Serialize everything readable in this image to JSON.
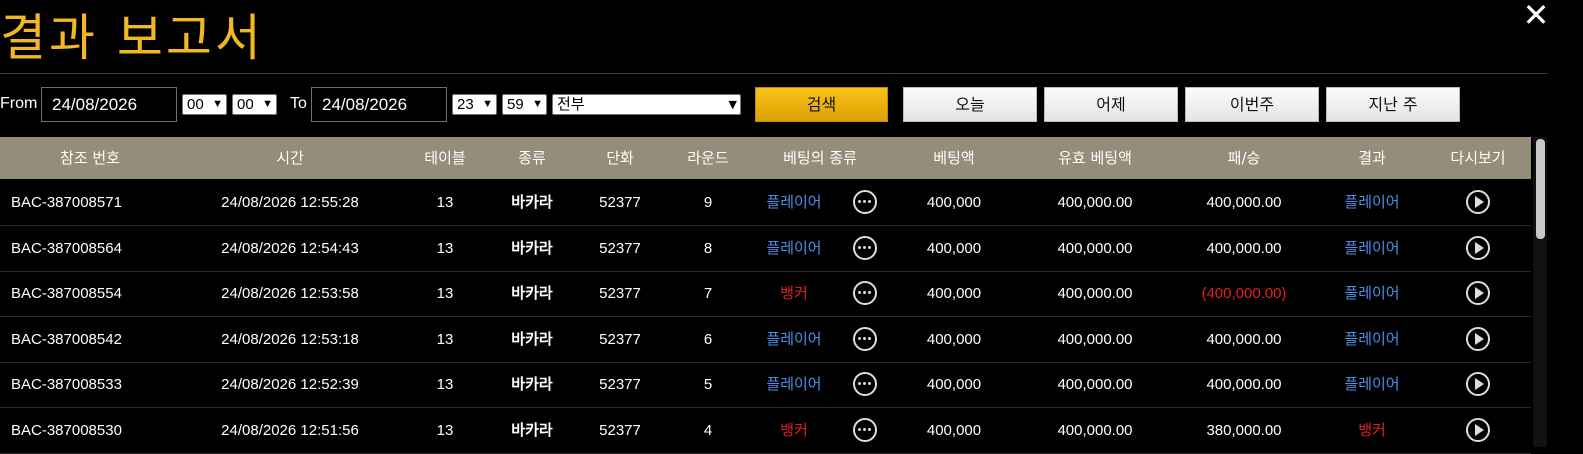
{
  "header": {
    "title": "결과 보고서",
    "close_glyph": "✕"
  },
  "filters": {
    "from_label": "From",
    "from_date": "24/08/2026",
    "from_hour": "00",
    "from_minute": "00",
    "to_label": "To",
    "to_date": "24/08/2026",
    "to_hour": "23",
    "to_minute": "59",
    "category": "전부",
    "search_label": "검색",
    "today_label": "오늘",
    "yesterday_label": "어제",
    "this_week_label": "이번주",
    "last_week_label": "지난 주"
  },
  "table": {
    "columns": [
      "참조 번호",
      "시간",
      "테이블",
      "종류",
      "단화",
      "라운드",
      "베팅의 종류",
      "베팅액",
      "유효 베팅액",
      "패/승",
      "결과",
      "다시보기"
    ],
    "rows": [
      {
        "ref": "BAC-387008571",
        "time": "24/08/2026 12:55:28",
        "table": "13",
        "game": "바카라",
        "shoe": "52377",
        "round": "9",
        "bet_type": "플레이어",
        "bet_color": "blue",
        "amount": "400,000",
        "valid": "400,000.00",
        "winloss": "400,000.00",
        "winloss_color": "white",
        "result": "플레이어",
        "result_color": "blue"
      },
      {
        "ref": "BAC-387008564",
        "time": "24/08/2026 12:54:43",
        "table": "13",
        "game": "바카라",
        "shoe": "52377",
        "round": "8",
        "bet_type": "플레이어",
        "bet_color": "blue",
        "amount": "400,000",
        "valid": "400,000.00",
        "winloss": "400,000.00",
        "winloss_color": "white",
        "result": "플레이어",
        "result_color": "blue"
      },
      {
        "ref": "BAC-387008554",
        "time": "24/08/2026 12:53:58",
        "table": "13",
        "game": "바카라",
        "shoe": "52377",
        "round": "7",
        "bet_type": "뱅커",
        "bet_color": "red",
        "amount": "400,000",
        "valid": "400,000.00",
        "winloss": "(400,000.00)",
        "winloss_color": "red",
        "result": "플레이어",
        "result_color": "blue"
      },
      {
        "ref": "BAC-387008542",
        "time": "24/08/2026 12:53:18",
        "table": "13",
        "game": "바카라",
        "shoe": "52377",
        "round": "6",
        "bet_type": "플레이어",
        "bet_color": "blue",
        "amount": "400,000",
        "valid": "400,000.00",
        "winloss": "400,000.00",
        "winloss_color": "white",
        "result": "플레이어",
        "result_color": "blue"
      },
      {
        "ref": "BAC-387008533",
        "time": "24/08/2026 12:52:39",
        "table": "13",
        "game": "바카라",
        "shoe": "52377",
        "round": "5",
        "bet_type": "플레이어",
        "bet_color": "blue",
        "amount": "400,000",
        "valid": "400,000.00",
        "winloss": "400,000.00",
        "winloss_color": "white",
        "result": "플레이어",
        "result_color": "blue"
      },
      {
        "ref": "BAC-387008530",
        "time": "24/08/2026 12:51:56",
        "table": "13",
        "game": "바카라",
        "shoe": "52377",
        "round": "4",
        "bet_type": "뱅커",
        "bet_color": "red",
        "amount": "400,000",
        "valid": "400,000.00",
        "winloss": "380,000.00",
        "winloss_color": "white",
        "result": "뱅커",
        "result_color": "red"
      }
    ]
  },
  "colors": {
    "title": "#f2b823",
    "header_bg": "#938d79",
    "blue": "#4a8fe8",
    "red": "#e02020",
    "primary_button": "#f0b712"
  },
  "icons": {
    "details": "more-dots-icon",
    "replay": "play-circle-icon",
    "close": "close-icon"
  }
}
